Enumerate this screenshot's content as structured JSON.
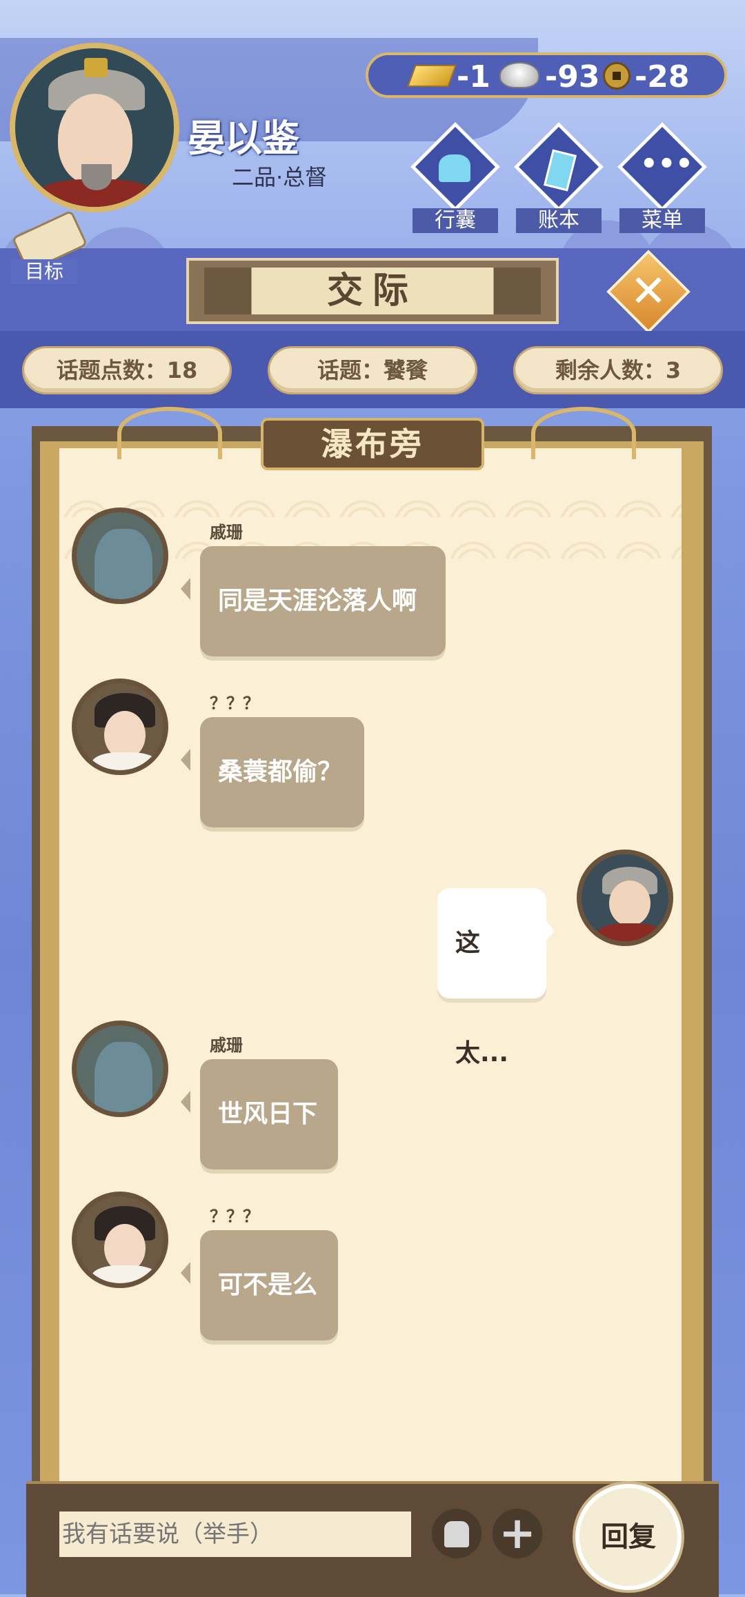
{
  "player": {
    "name": "晏以鉴",
    "title": "二品·总督"
  },
  "currency": {
    "gold": "-1",
    "silver": "-93",
    "coin": "-28"
  },
  "menu_buttons": [
    {
      "label": "行囊",
      "icon": "bag-icon"
    },
    {
      "label": "账本",
      "icon": "ledger-icon"
    },
    {
      "label": "菜单",
      "icon": "more-icon"
    }
  ],
  "goal": {
    "label": "目标"
  },
  "screen_title": "交际",
  "close_icon": "close-icon",
  "info": {
    "topic_points": "话题点数：18",
    "topic": "话题：饕餮",
    "remaining": "剩余人数：3"
  },
  "scene": {
    "name": "瀑布旁"
  },
  "messages": [
    {
      "sender": "戚珊",
      "text": "同是天涯沦落人啊",
      "self": false
    },
    {
      "sender": "？？？",
      "text": "桑蓑都偷？",
      "self": false
    },
    {
      "sender": "",
      "text": "这太...",
      "self": true
    },
    {
      "sender": "戚珊",
      "text": "世风日下",
      "self": false
    },
    {
      "sender": "？？？",
      "text": "可不是么",
      "self": false
    }
  ],
  "input": {
    "placeholder": "我有话要说（举手）"
  },
  "reply_label": "回复",
  "colors": {
    "panel": "#fbf0d6",
    "bubble_other": "#b8a78b",
    "bubble_self": "#ffffff",
    "frame": "#6c5741",
    "gold": "#d9b768"
  }
}
